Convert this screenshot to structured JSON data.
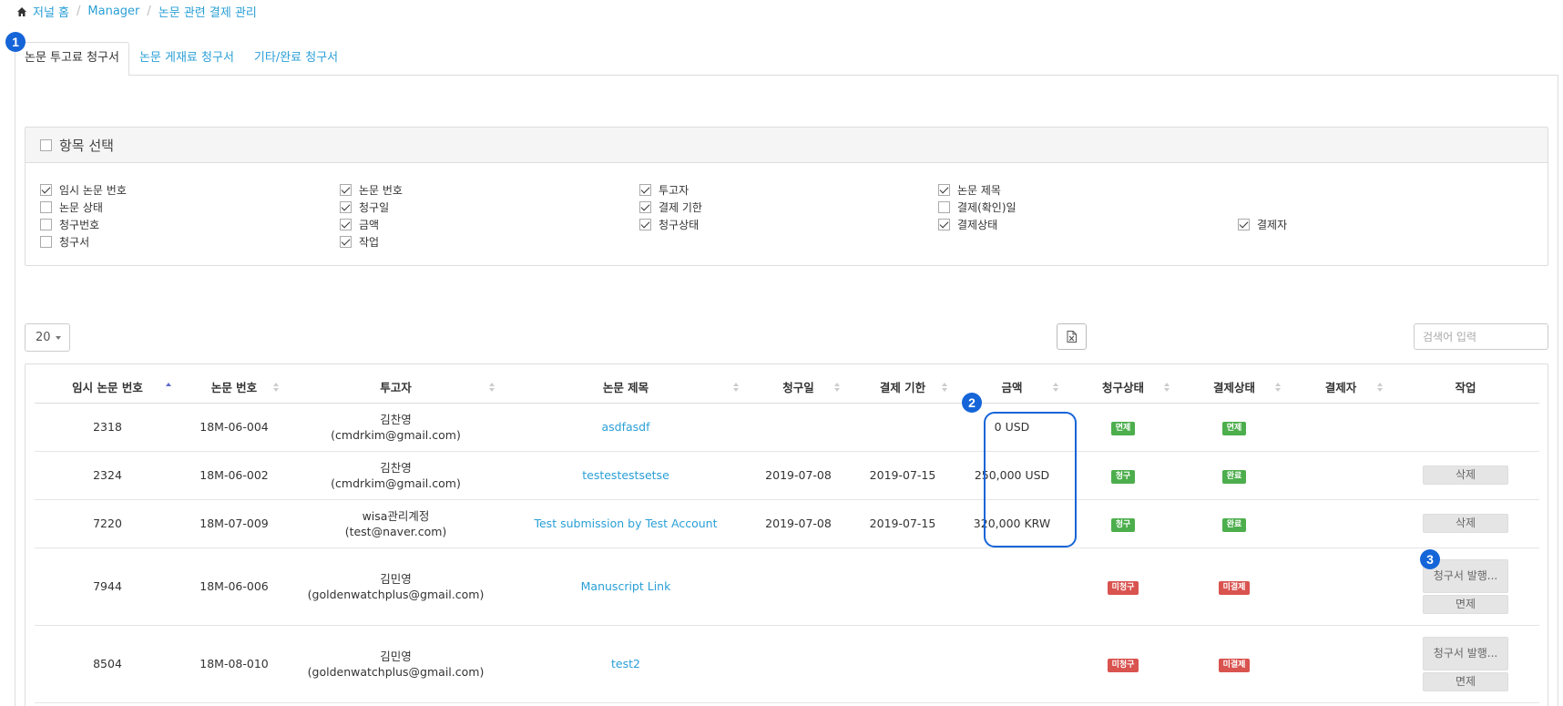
{
  "breadcrumb": {
    "home": "저널 홈",
    "manager": "Manager",
    "current": "논문 관련 결제 관리"
  },
  "markers": [
    "1",
    "2",
    "3"
  ],
  "tabs": [
    {
      "label": "논문 투고료 청구서"
    },
    {
      "label": "논문 게재료 청구서"
    },
    {
      "label": "기타/완료 청구서"
    }
  ],
  "column_selector": {
    "title": "항목 선택",
    "items": [
      {
        "label": "임시 논문 번호",
        "checked": true
      },
      {
        "label": "논문 번호",
        "checked": true
      },
      {
        "label": "투고자",
        "checked": true
      },
      {
        "label": "논문 제목",
        "checked": true
      },
      {
        "label": "논문 상태",
        "checked": false
      },
      {
        "label": "청구일",
        "checked": true
      },
      {
        "label": "결제 기한",
        "checked": true
      },
      {
        "label": "결제(확인)일",
        "checked": false
      },
      {
        "label": "청구번호",
        "checked": false
      },
      {
        "label": "금액",
        "checked": true
      },
      {
        "label": "청구상태",
        "checked": true
      },
      {
        "label": "결제상태",
        "checked": true
      },
      {
        "label": "결제자",
        "checked": true
      },
      {
        "label": "청구서",
        "checked": false
      },
      {
        "label": "작업",
        "checked": true
      }
    ]
  },
  "toolbar": {
    "page_size": "20",
    "search_placeholder": "검색어 입력"
  },
  "table": {
    "headers": [
      "임시 논문 번호",
      "논문 번호",
      "투고자",
      "논문 제목",
      "청구일",
      "결제 기한",
      "금액",
      "청구상태",
      "결제상태",
      "결제자",
      "작업"
    ],
    "rows": [
      {
        "temp_no": "2318",
        "paper_no": "18M-06-004",
        "author": "김찬영",
        "email": "(cmdrkim@gmail.com)",
        "title": "asdfasdf",
        "bill_date": "",
        "due_date": "",
        "amount": "0 USD",
        "bill_status": "면제",
        "pay_status": "면제",
        "payer": "",
        "actions": []
      },
      {
        "temp_no": "2324",
        "paper_no": "18M-06-002",
        "author": "김찬영",
        "email": "(cmdrkim@gmail.com)",
        "title": "testestestsetse",
        "bill_date": "2019-07-08",
        "due_date": "2019-07-15",
        "amount": "250,000 USD",
        "bill_status": "청구",
        "pay_status": "완료",
        "payer": "",
        "actions": [
          "삭제"
        ]
      },
      {
        "temp_no": "7220",
        "paper_no": "18M-07-009",
        "author": "wisa관리계정",
        "email": "(test@naver.com)",
        "title": "Test submission by Test Account",
        "bill_date": "2019-07-08",
        "due_date": "2019-07-15",
        "amount": "320,000 KRW",
        "bill_status": "청구",
        "pay_status": "완료",
        "payer": "",
        "actions": [
          "삭제"
        ]
      },
      {
        "temp_no": "7944",
        "paper_no": "18M-06-006",
        "author": "김민영",
        "email": "(goldenwatchplus@gmail.com)",
        "title": "Manuscript Link",
        "bill_date": "",
        "due_date": "",
        "amount": "",
        "bill_status": "미청구",
        "pay_status": "미결제",
        "payer": "",
        "actions": [
          "청구서 발행...",
          "면제"
        ]
      },
      {
        "temp_no": "8504",
        "paper_no": "18M-08-010",
        "author": "김민영",
        "email": "(goldenwatchplus@gmail.com)",
        "title": "test2",
        "bill_date": "",
        "due_date": "",
        "amount": "",
        "bill_status": "미청구",
        "pay_status": "미결제",
        "payer": "",
        "actions": [
          "청구서 발행...",
          "면제"
        ]
      }
    ]
  },
  "colors": {
    "link": "#2a9fd6",
    "marker": "#1565d8",
    "badge_green": "#4cae4c",
    "badge_red": "#d9534f"
  }
}
